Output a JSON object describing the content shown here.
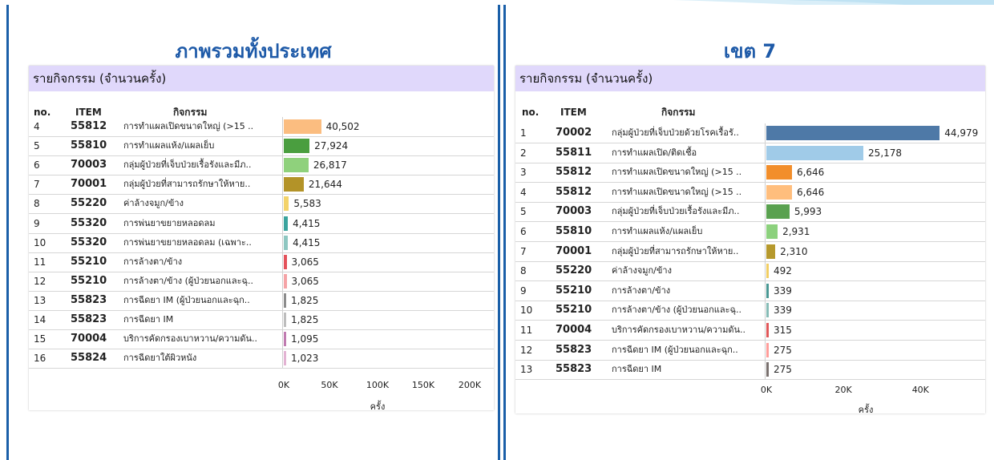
{
  "chart_data": [
    {
      "type": "bar",
      "pane_title": "ภาพรวมทั้งประเทศ",
      "title": "รายกิจกรรม (จำนวนครั้ง)",
      "columns": [
        "no.",
        "ITEM",
        "กิจกรรม"
      ],
      "rows": [
        {
          "no": "4",
          "item": "55812",
          "activity": "การทำแผลเปิดขนาดใหญ่ (>15 ..",
          "value": 40502,
          "label": "40,502",
          "color": "#fbbd80"
        },
        {
          "no": "5",
          "item": "55810",
          "activity": "การทำแผลแห้ง/แผลเย็บ",
          "value": 27924,
          "label": "27,924",
          "color": "#4a9e3f"
        },
        {
          "no": "6",
          "item": "70003",
          "activity": "กลุ่มผู้ป่วยที่เจ็บป่วยเรื้อรังและมีภ..",
          "value": 26817,
          "label": "26,817",
          "color": "#8fd17c"
        },
        {
          "no": "7",
          "item": "70001",
          "activity": "กลุ่มผู้ป่วยที่สามารถรักษาให้หาย..",
          "value": 21644,
          "label": "21,644",
          "color": "#b39328"
        },
        {
          "no": "8",
          "item": "55220",
          "activity": "ค่าล้างจมูก/ข้าง",
          "value": 5583,
          "label": "5,583",
          "color": "#f3d36a"
        },
        {
          "no": "9",
          "item": "55320",
          "activity": "การพ่นยาขยายหลอดลม",
          "value": 4415,
          "label": "4,415",
          "color": "#3aa39d"
        },
        {
          "no": "10",
          "item": "55320",
          "activity": "การพ่นยาขยายหลอดลม (เฉพาะ..",
          "value": 4415,
          "label": "4,415",
          "color": "#8ec7c1"
        },
        {
          "no": "11",
          "item": "55210",
          "activity": "การล้างตา/ข้าง",
          "value": 3065,
          "label": "3,065",
          "color": "#e4515a"
        },
        {
          "no": "12",
          "item": "55210",
          "activity": "การล้างตา/ข้าง (ผู้ป่วยนอกและฉุ..",
          "value": 3065,
          "label": "3,065",
          "color": "#f5a3a6"
        },
        {
          "no": "13",
          "item": "55823",
          "activity": "การฉีดยา IM (ผู้ป่วยนอกและฉุก..",
          "value": 1825,
          "label": "1,825",
          "color": "#8c8c8c"
        },
        {
          "no": "14",
          "item": "55823",
          "activity": "การฉีดยา IM",
          "value": 1825,
          "label": "1,825",
          "color": "#bdbdbd"
        },
        {
          "no": "15",
          "item": "70004",
          "activity": "บริการคัดกรองเบาหวาน/ความดัน..",
          "value": 1095,
          "label": "1,095",
          "color": "#c07bb0"
        },
        {
          "no": "16",
          "item": "55824",
          "activity": "การฉีดยาใต้ผิวหนัง",
          "value": 1023,
          "label": "1,023",
          "color": "#e3b3d3"
        }
      ],
      "xlim": [
        0,
        200000
      ],
      "xticks": [
        "0K",
        "50K",
        "100K",
        "150K",
        "200K"
      ],
      "xlabel": "ครั้ง"
    },
    {
      "type": "bar",
      "pane_title": "เขต 7",
      "title": "รายกิจกรรม (จำนวนครั้ง)",
      "columns": [
        "no.",
        "ITEM",
        "กิจกรรม"
      ],
      "rows": [
        {
          "no": "1",
          "item": "70002",
          "activity": "กลุ่มผู้ป่วยที่เจ็บป่วยด้วยโรคเรื้อรั..",
          "value": 44979,
          "label": "44,979",
          "color": "#4e79a7"
        },
        {
          "no": "2",
          "item": "55811",
          "activity": "การทำแผลเปิด/ติดเชื้อ",
          "value": 25178,
          "label": "25,178",
          "color": "#a0cbe8"
        },
        {
          "no": "3",
          "item": "55812",
          "activity": "การทำแผลเปิดขนาดใหญ่ (>15 ..",
          "value": 6646,
          "label": "6,646",
          "color": "#f28e2b"
        },
        {
          "no": "4",
          "item": "55812",
          "activity": "การทำแผลเปิดขนาดใหญ่ (>15 ..",
          "value": 6646,
          "label": "6,646",
          "color": "#ffbe7d"
        },
        {
          "no": "5",
          "item": "70003",
          "activity": "กลุ่มผู้ป่วยที่เจ็บป่วยเรื้อรังและมีภ..",
          "value": 5993,
          "label": "5,993",
          "color": "#59a14f"
        },
        {
          "no": "6",
          "item": "55810",
          "activity": "การทำแผลแห้ง/แผลเย็บ",
          "value": 2931,
          "label": "2,931",
          "color": "#8cd17d"
        },
        {
          "no": "7",
          "item": "70001",
          "activity": "กลุ่มผู้ป่วยที่สามารถรักษาให้หาย..",
          "value": 2310,
          "label": "2,310",
          "color": "#b6992d"
        },
        {
          "no": "8",
          "item": "55220",
          "activity": "ค่าล้างจมูก/ข้าง",
          "value": 492,
          "label": "492",
          "color": "#f1ce63"
        },
        {
          "no": "9",
          "item": "55210",
          "activity": "การล้างตา/ข้าง",
          "value": 339,
          "label": "339",
          "color": "#499894"
        },
        {
          "no": "10",
          "item": "55210",
          "activity": "การล้างตา/ข้าง (ผู้ป่วยนอกและฉุ..",
          "value": 339,
          "label": "339",
          "color": "#86bcb6"
        },
        {
          "no": "11",
          "item": "70004",
          "activity": "บริการคัดกรองเบาหวาน/ความดัน..",
          "value": 315,
          "label": "315",
          "color": "#e15759"
        },
        {
          "no": "12",
          "item": "55823",
          "activity": "การฉีดยา IM (ผู้ป่วยนอกและฉุก..",
          "value": 275,
          "label": "275",
          "color": "#ff9d9a"
        },
        {
          "no": "13",
          "item": "55823",
          "activity": "การฉีดยา IM",
          "value": 275,
          "label": "275",
          "color": "#79706e"
        }
      ],
      "xlim": [
        0,
        52000
      ],
      "xticks": [
        "0K",
        "20K",
        "40K"
      ],
      "xtick_values": [
        0,
        20000,
        40000
      ],
      "xlabel": "ครั้ง"
    }
  ]
}
